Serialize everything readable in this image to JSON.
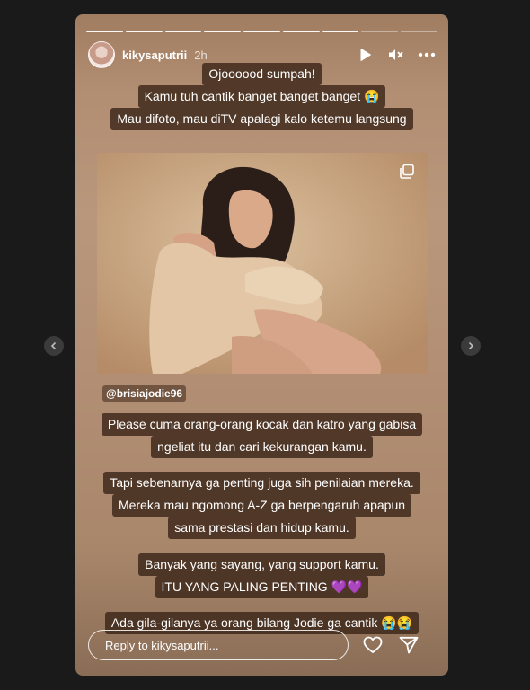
{
  "story": {
    "username": "kikysaputrii",
    "time": "2h",
    "progress_segments_total": 9,
    "progress_segments_done": 7
  },
  "captions_top": [
    "Ojoooood sumpah!",
    "Kamu tuh cantik banget banget banget 😭",
    "Mau difoto, mau diTV apalagi kalo ketemu langsung"
  ],
  "mention": "@brisiajodie96",
  "captions_block1": [
    "Please cuma orang-orang kocak dan katro yang gabisa",
    "ngeliat itu dan cari kekurangan kamu."
  ],
  "captions_block2": [
    "Tapi sebenarnya ga penting juga sih penilaian mereka.",
    "Mereka mau ngomong A-Z ga  berpengaruh apapun",
    "sama prestasi dan hidup kamu."
  ],
  "captions_block3": [
    "Banyak yang sayang, yang support kamu.",
    "ITU YANG PALING PENTING 💜💜"
  ],
  "captions_block4": [
    "Ada gila-gilanya ya orang bilang Jodie ga cantik 😭😭"
  ],
  "reply": {
    "placeholder": "Reply to kikysaputrii..."
  },
  "icons": {
    "play": "play-icon",
    "mute": "speaker-muted-icon",
    "more": "more-horizontal-icon",
    "copy": "multiple-posts-icon",
    "heart": "heart-icon",
    "send": "send-icon",
    "prev": "chevron-left-icon",
    "next": "chevron-right-icon"
  }
}
